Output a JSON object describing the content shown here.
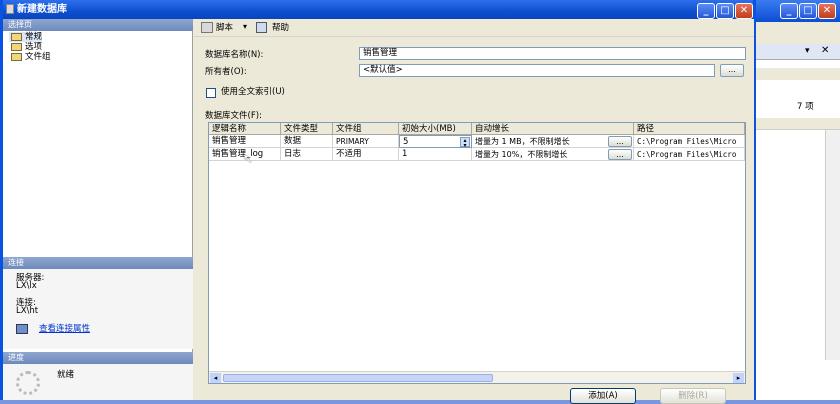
{
  "window": {
    "title": "新建数据库"
  },
  "left": {
    "select_page_header": "选择页",
    "nav_items": [
      "常规",
      "选项",
      "文件组"
    ],
    "connection_header": "连接",
    "server_label": "服务器:",
    "server_value": "LX\\lx",
    "connection_label": "连接:",
    "connection_value": "LX\\ht",
    "view_conn_link": "查看连接属性",
    "progress_header": "进度",
    "progress_status": "就绪"
  },
  "toolbar": {
    "script_label": "脚本",
    "help_label": "帮助"
  },
  "form": {
    "db_name_label": "数据库名称(N):",
    "db_name_value": "销售管理",
    "owner_label": "所有者(O):",
    "owner_value": "<默认值>",
    "fulltext_label": "使用全文索引(U)",
    "files_label": "数据库文件(F):"
  },
  "grid": {
    "columns": [
      "逻辑名称",
      "文件类型",
      "文件组",
      "初始大小(MB)",
      "自动增长",
      "路径"
    ],
    "rows": [
      {
        "name": "销售管理",
        "type": "数据",
        "group": "PRIMARY",
        "size": "5",
        "growth": "增量为 1 MB，不限制增长",
        "path": "C:\\Program Files\\Micro"
      },
      {
        "name": "销售管理_log",
        "type": "日志",
        "group": "不适用",
        "size": "1",
        "growth": "增量为 10%，不限制增长",
        "path": "C:\\Program Files\\Micro"
      }
    ]
  },
  "buttons": {
    "add_label": "添加(A)",
    "remove_label": "删除(R)",
    "browse_label": "..."
  },
  "background_window": {
    "count_text": "7 项"
  }
}
